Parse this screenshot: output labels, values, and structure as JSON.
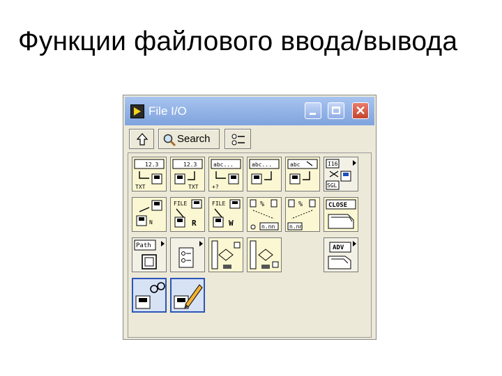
{
  "slide": {
    "title": "Функции файлового ввода/вывода"
  },
  "window": {
    "title": "File I/O"
  },
  "toolbar": {
    "search_label": "Search"
  },
  "icons": {
    "num_text": "12.3",
    "abc_text": "abc...",
    "abc_arrow_text": "abc",
    "txt_text": "TXT",
    "plus_text": "+?",
    "i16_text": "I16",
    "sgl_text": "SGL",
    "file_text": "FILE",
    "r_text": "R",
    "w_text": "W",
    "n_text": "N",
    "percent_text": "%",
    "nnn_text": "n.nn",
    "close_text": "CLOSE",
    "path_text": "Path",
    "adv_text": "ADV"
  },
  "colors": {
    "vi_fill": "#fbf7d2",
    "titlebar_top": "#a8c4f0",
    "titlebar_bottom": "#7fa3dd",
    "close_red": "#c5432c",
    "selection_blue": "#2c55b8"
  }
}
